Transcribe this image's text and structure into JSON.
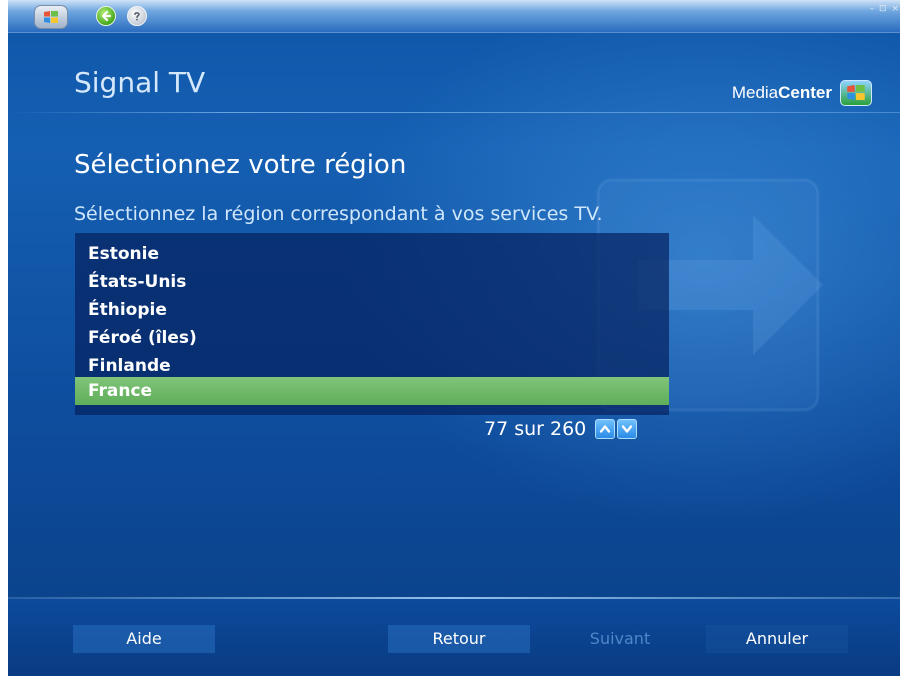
{
  "window": {
    "controls": "– ⊡ ×"
  },
  "header": {
    "title": "Signal TV",
    "brand_media": "Media",
    "brand_center": "Center"
  },
  "page": {
    "heading": "Sélectionnez votre région",
    "subheading": "Sélectionnez la région correspondant à vos services TV."
  },
  "region_list": {
    "items": [
      {
        "label": "Estonie",
        "selected": false
      },
      {
        "label": "États-Unis",
        "selected": false
      },
      {
        "label": "Éthiopie",
        "selected": false
      },
      {
        "label": "Féroé (îles)",
        "selected": false
      },
      {
        "label": "Finlande",
        "selected": false
      },
      {
        "label": "France",
        "selected": true
      }
    ]
  },
  "pager": {
    "text": "77 sur 260"
  },
  "footer": {
    "help": "Aide",
    "back": "Retour",
    "next": "Suivant",
    "cancel": "Annuler"
  },
  "colors": {
    "background": "#0f56a8",
    "selected_item": "#6fb86a",
    "disabled_text": "#4f86c7"
  },
  "icons": {
    "start": "windows-flag-icon",
    "back": "back-arrow-icon",
    "help": "help-question-icon",
    "scroll_up": "chevron-up-icon",
    "scroll_down": "chevron-down-icon",
    "brand_logo": "windows-flag-icon"
  }
}
